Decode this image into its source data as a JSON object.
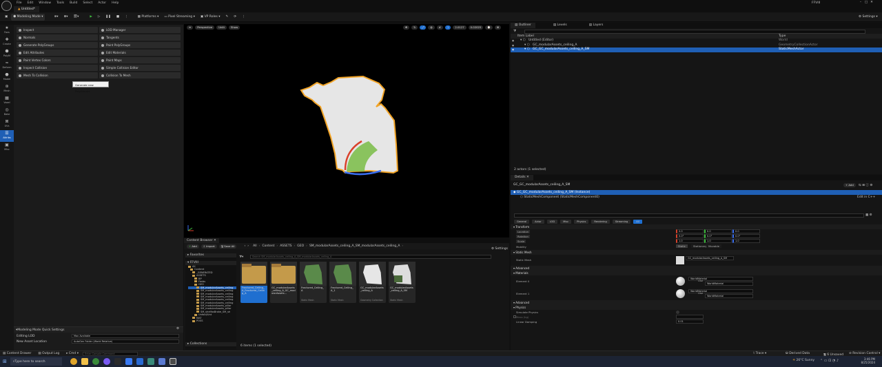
{
  "menubar": {
    "items": [
      "File",
      "Edit",
      "Window",
      "Tools",
      "Build",
      "Select",
      "Actor",
      "Help"
    ],
    "project": "FFVIII"
  },
  "tab": {
    "label": "Untitled*"
  },
  "toolbar": {
    "mode_label": "Modeling Mode",
    "platforms_label": "Platforms",
    "pixel_streaming_label": "Pixel Streaming",
    "vp_roles_label": "VP Roles",
    "settings_label": "Settings"
  },
  "left_icons": [
    {
      "icon": "favorites-icon",
      "label": "Favs"
    },
    {
      "icon": "create-icon",
      "label": "Create"
    },
    {
      "icon": "polymodel-icon",
      "label": "PolyM"
    },
    {
      "icon": "deform-icon",
      "label": "Deform"
    },
    {
      "icon": "model-icon",
      "label": "Model"
    },
    {
      "icon": "mesh-icon",
      "label": "Mesh"
    },
    {
      "icon": "voxel-icon",
      "label": "Voxel"
    },
    {
      "icon": "bake-icon",
      "label": "Bake"
    },
    {
      "icon": "uvs-icon",
      "label": "UVs"
    },
    {
      "icon": "attribs-icon",
      "label": "Attribs",
      "active": true
    },
    {
      "icon": "misc-icon",
      "label": "Misc"
    }
  ],
  "mode_buttons_left": [
    "Inspect",
    "Normals",
    "Generate PolyGroups",
    "Edit Attributes",
    "Paint Vertex Colors",
    "Inspect Collision",
    "Mesh To Collision"
  ],
  "mode_buttons_right": [
    "LOD Manager",
    "Tangents",
    "Paint PolyGroups",
    "Edit Materials",
    "Paint Maps",
    "Simple Collision Editor",
    "Collision To Mesh"
  ],
  "tooltip": "Generate new PolyGroups",
  "quick_settings": {
    "title": "Modeling Mode Quick Settings",
    "editing_lod_label": "Editing LOD",
    "editing_lod_value": "Max Available",
    "new_asset_label": "New Asset Location",
    "new_asset_value": "AutoGen Folder (World Relative)"
  },
  "viewport": {
    "perspective": "Perspective",
    "lit": "Unlit",
    "show": "Show",
    "snap1": "2.0127",
    "snap2": "0.02025",
    "snap3": "1"
  },
  "content_browser": {
    "tab_label": "Content Browser",
    "add_label": "Add",
    "import_label": "Import",
    "save_all_label": "Save All",
    "breadcrumb": [
      "All",
      "Content",
      "ASSETS",
      "GEO",
      "SM_modularAssets_ceiling_A_SM_modularAssets_ceiling_A"
    ],
    "settings_label": "Settings",
    "search_placeholder": "Search SM_modularAssets_ceiling_A_SM_modularAssets_ceiling_A",
    "favorites_label": "Favorites",
    "project_label": "FFVIII",
    "collections_label": "Collections",
    "folders": [
      "All",
      "Content",
      "_GENERATED",
      "ASSETS",
      "BP",
      "Fields",
      "GEO",
      "SM_modularAssets_ceiling",
      "SM_modularAssets_ceiling",
      "SM_modularAssets_ceiling",
      "SM_modularAssets_ceiling",
      "SM_modularAssets_ceiling",
      "SM_modularAssets_ceiling",
      "SM_modularAssets_pillar",
      "SM_modularAssets_pillar",
      "SM_shelfasBroke_SM_sh",
      "Unfold/Unt",
      "MAT",
      "POSS"
    ],
    "assets": [
      {
        "name": "Fractured_Ceiling_A_Fractured_Ceiling_A",
        "type": "",
        "kind": "folder",
        "selected": true
      },
      {
        "name": "GC_modularAssets_ceiling_A_GC_modularAssets...",
        "type": "",
        "kind": "folder",
        "selected": false
      },
      {
        "name": "Fractured_Ceiling_A",
        "type": "Static Mesh",
        "kind": "green",
        "selected": false
      },
      {
        "name": "Fractured_Ceiling_A_1",
        "type": "Static Mesh",
        "kind": "green",
        "selected": false
      },
      {
        "name": "GC_modularAssets_ceiling_A",
        "type": "Geometry Collection",
        "kind": "white",
        "selected": false
      },
      {
        "name": "GC_modularAssets_ceiling_A_SM",
        "type": "Static Mesh",
        "kind": "dark",
        "selected": false
      }
    ],
    "status": "6 items (1 selected)"
  },
  "outliner": {
    "tabs": [
      "Outliner",
      "Levels",
      "Layers"
    ],
    "col_label": "Item Label",
    "col_type": "Type",
    "rows": [
      {
        "label": "Untitled (Editor)",
        "type": "World",
        "indent": 1
      },
      {
        "label": "GC_modularAssets_ceiling_A",
        "type": "GeometryCollectionActor",
        "indent": 2
      },
      {
        "label": "GC_GC_modularAssets_ceiling_A_SM",
        "type": "StaticMeshActor",
        "indent": 2,
        "selected": true
      }
    ],
    "status": "2 actors (1 selected)"
  },
  "details": {
    "tab_label": "Details",
    "actor_name": "GC_GC_modularAssets_ceiling_A_SM",
    "add_label": "Add",
    "instance_label": "GC_GC_modularAssets_ceiling_A_SM (Instance)",
    "component_label": "StaticMeshComponent (StaticMeshComponent0)",
    "edit_in_cpp": "Edit in C++",
    "filters": [
      "General",
      "Actor",
      "LOD",
      "Misc",
      "Physics",
      "Rendering",
      "Streaming",
      "All"
    ],
    "sections": {
      "transform": "Transform",
      "static_mesh": "Static Mesh",
      "advanced": "Advanced",
      "materials": "Materials",
      "physics": "Physics"
    },
    "location_label": "Location",
    "rotation_label": "Rotation",
    "scale_label": "Scale",
    "location": [
      "0.0",
      "0.0",
      "0.0"
    ],
    "rotation": [
      "0.0°",
      "0.0°",
      "0.0°"
    ],
    "scale": [
      "1.0",
      "1.0",
      "1.0"
    ],
    "mobility_label": "Mobility",
    "mobility": [
      "Static",
      "Stationary",
      "Movable"
    ],
    "static_mesh_label": "Static Mesh",
    "static_mesh_value": "GC_modularAssets_ceiling_A_SM",
    "element0_label": "Element 0",
    "element1_label": "Element 1",
    "material_value": "WorldMaterial",
    "use_label": "Use",
    "simulate_label": "Simulate Physics",
    "mass_label": "Mass (kg)",
    "linear_damping_label": "Linear Damping",
    "linear_damping_value": "0.01"
  },
  "statusbar": {
    "content_drawer": "Content Drawer",
    "output_log": "Output Log",
    "cmd": "Cmd",
    "cmd_placeholder": "Enter Console Command",
    "trace": "Trace",
    "derived_data": "Derived Data",
    "unsaved": "6 Unsaved",
    "revision": "Revision Control"
  },
  "taskbar": {
    "search_placeholder": "Type here to search",
    "weather": "26°C  Sunny",
    "time": "3:46 PM",
    "date": "8/25/2024"
  },
  "colors": {
    "accent": "#1f6fd0",
    "selected_row": "#1f5fb5",
    "outline": "#f2a427",
    "play_green": "#3fbf3f"
  }
}
